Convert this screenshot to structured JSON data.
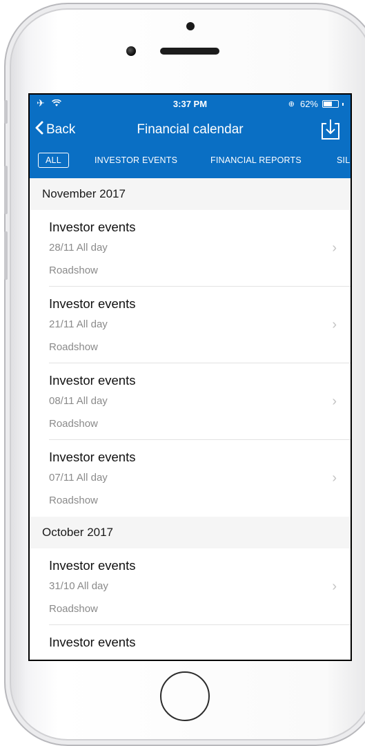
{
  "status_bar": {
    "time": "3:37 PM",
    "battery_text": "62%",
    "battery_level": 0.62
  },
  "navbar": {
    "back_label": "Back",
    "title": "Financial calendar"
  },
  "filters": {
    "all": "ALL",
    "investor_events": "INVESTOR EVENTS",
    "financial_reports": "FINANCIAL REPORTS",
    "truncated": "SIL"
  },
  "sections": [
    {
      "header": "November 2017",
      "events": [
        {
          "title": "Investor events",
          "date": "28/11 All day",
          "type": "Roadshow"
        },
        {
          "title": "Investor events",
          "date": "21/11 All day",
          "type": "Roadshow"
        },
        {
          "title": "Investor events",
          "date": "08/11 All day",
          "type": "Roadshow"
        },
        {
          "title": "Investor events",
          "date": "07/11 All day",
          "type": "Roadshow"
        }
      ]
    },
    {
      "header": "October 2017",
      "events": [
        {
          "title": "Investor events",
          "date": "31/10 All day",
          "type": "Roadshow"
        },
        {
          "title": "Investor events"
        }
      ]
    }
  ],
  "colors": {
    "brand_blue": "#0a6fc4",
    "section_bg": "#f5f5f5",
    "secondary_text": "#8a8a8a"
  }
}
